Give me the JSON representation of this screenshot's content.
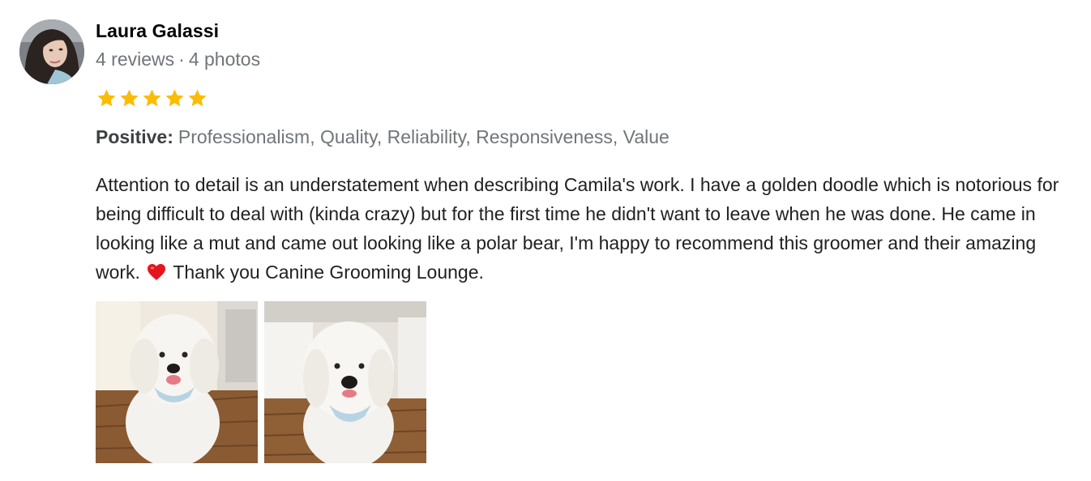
{
  "review": {
    "author": {
      "name": "Laura Galassi",
      "reviews": "4 reviews",
      "separator": "·",
      "photos": "4 photos"
    },
    "rating": {
      "value": 5,
      "max": 5,
      "star_color": "#fbbc04"
    },
    "attributes": {
      "label": "Positive:",
      "values": "Professionalism, Quality, Reliability, Responsiveness, Value"
    },
    "text_before_emoji": "Attention to detail is an understatement when describing Camila's work. I have a golden doodle which is notorious for being difficult to deal with (kinda crazy) but for the first time he didn't want to leave when he was done. He came in looking like a mut and came out looking like a polar bear, I'm happy to recommend this groomer and their amazing work.",
    "emoji_icon": "red-heart-icon",
    "text_after_emoji": "Thank you Canine Grooming Lounge.",
    "photo_items": [
      {
        "icon": "dog-photo-icon"
      },
      {
        "icon": "dog-photo-icon"
      }
    ]
  }
}
